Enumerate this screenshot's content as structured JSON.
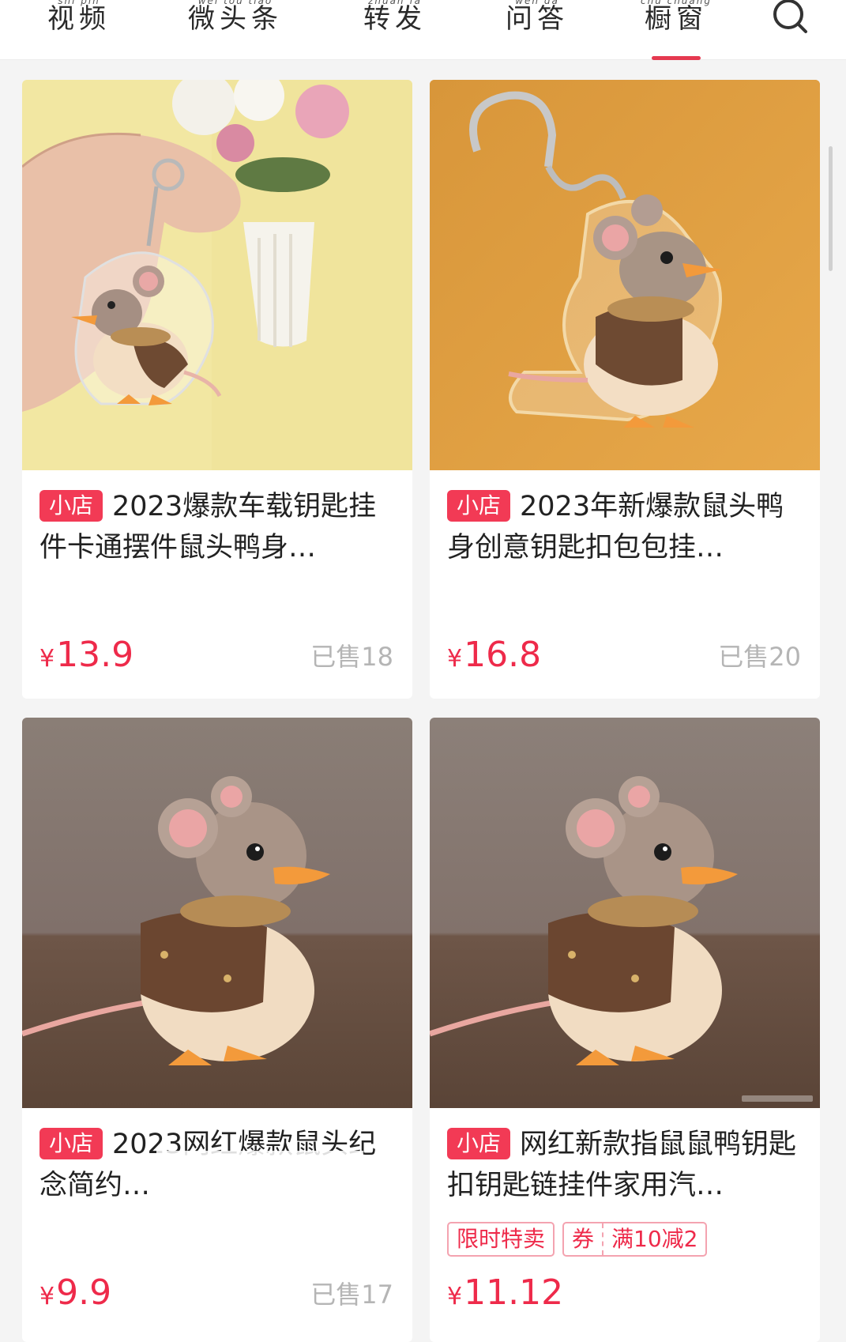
{
  "nav": {
    "tabs": [
      {
        "pinyin": "shì pín",
        "label": "视频"
      },
      {
        "pinyin": "wēi tóu tiáo",
        "label": "微头条"
      },
      {
        "pinyin": "zhuǎn fā",
        "label": "转发"
      },
      {
        "pinyin": "wèn dá",
        "label": "问答"
      },
      {
        "pinyin": "chú chuāng",
        "label": "橱窗"
      }
    ],
    "active_tab": "橱窗",
    "search_icon": "search-icon",
    "accent_color": "#e53950"
  },
  "products": [
    {
      "tag": "小店",
      "title": "2023爆款车载钥匙挂件卡通摆件鼠头鸭身…",
      "currency": "¥",
      "price": "13.9",
      "sold": "已售18"
    },
    {
      "tag": "小店",
      "title": "2023年新爆款鼠头鸭身创意钥匙扣包包挂…",
      "currency": "¥",
      "price": "16.8",
      "sold": "已售20"
    },
    {
      "tag": "小店",
      "title": "2023网红爆款鼠头纪念简约…",
      "currency": "¥",
      "price": "9.9",
      "sold": "已售17"
    },
    {
      "tag": "小店",
      "title": "网红新款指鼠鼠鸭钥匙扣钥匙链挂件家用汽…",
      "promo_label": "限时特卖",
      "coupon_label": "券",
      "coupon_value": "满10减2",
      "currency": "¥",
      "price": "11.12"
    }
  ],
  "colors": {
    "price": "#ee2a4a",
    "tag_bg": "#f23a55",
    "sold": "#b5b5b5"
  }
}
